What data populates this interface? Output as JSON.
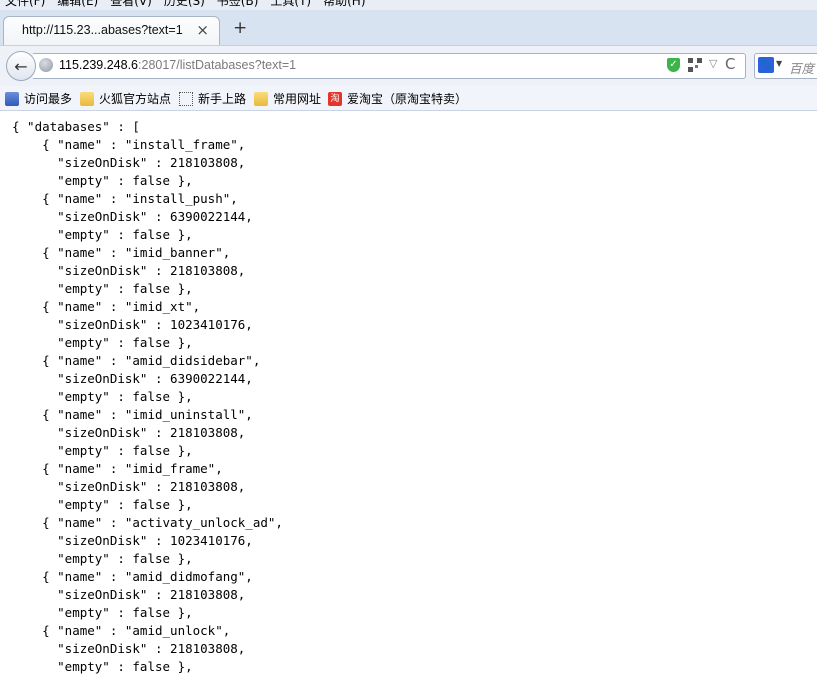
{
  "menu": [
    "文件(F)",
    "编辑(E)",
    "查看(V)",
    "历史(S)",
    "书签(B)",
    "工具(T)",
    "帮助(H)"
  ],
  "tab": {
    "title": "http://115.23...abases?text=1",
    "close": "×",
    "new_tab": "+"
  },
  "navbar": {
    "back": "←",
    "url_host": "115.239.248.6",
    "url_rest": ":28017/listDatabases?text=1",
    "dropdown": "▽",
    "reload": "C",
    "search_placeholder": "百度"
  },
  "bookmarks": [
    {
      "label": "访问最多",
      "icon": "most-visited-icon"
    },
    {
      "label": "火狐官方站点",
      "icon": "folder-icon"
    },
    {
      "label": "新手上路",
      "icon": "dotted-page-icon"
    },
    {
      "label": "常用网址",
      "icon": "folder-icon"
    },
    {
      "label": "爱淘宝（原淘宝特卖）",
      "icon": "taobao-icon"
    }
  ],
  "icons": {
    "shield": "shield-check-icon",
    "qr": "qr-code-icon",
    "paw": "baidu-paw-icon"
  },
  "content": {
    "text": "{ \"databases\" : [\n    { \"name\" : \"install_frame\",\n      \"sizeOnDisk\" : 218103808,\n      \"empty\" : false },\n    { \"name\" : \"install_push\",\n      \"sizeOnDisk\" : 6390022144,\n      \"empty\" : false },\n    { \"name\" : \"imid_banner\",\n      \"sizeOnDisk\" : 218103808,\n      \"empty\" : false },\n    { \"name\" : \"imid_xt\",\n      \"sizeOnDisk\" : 1023410176,\n      \"empty\" : false },\n    { \"name\" : \"amid_didsidebar\",\n      \"sizeOnDisk\" : 6390022144,\n      \"empty\" : false },\n    { \"name\" : \"imid_uninstall\",\n      \"sizeOnDisk\" : 218103808,\n      \"empty\" : false },\n    { \"name\" : \"imid_frame\",\n      \"sizeOnDisk\" : 218103808,\n      \"empty\" : false },\n    { \"name\" : \"activaty_unlock_ad\",\n      \"sizeOnDisk\" : 1023410176,\n      \"empty\" : false },\n    { \"name\" : \"amid_didmofang\",\n      \"sizeOnDisk\" : 218103808,\n      \"empty\" : false },\n    { \"name\" : \"amid_unlock\",\n      \"sizeOnDisk\" : 218103808,\n      \"empty\" : false },"
  }
}
